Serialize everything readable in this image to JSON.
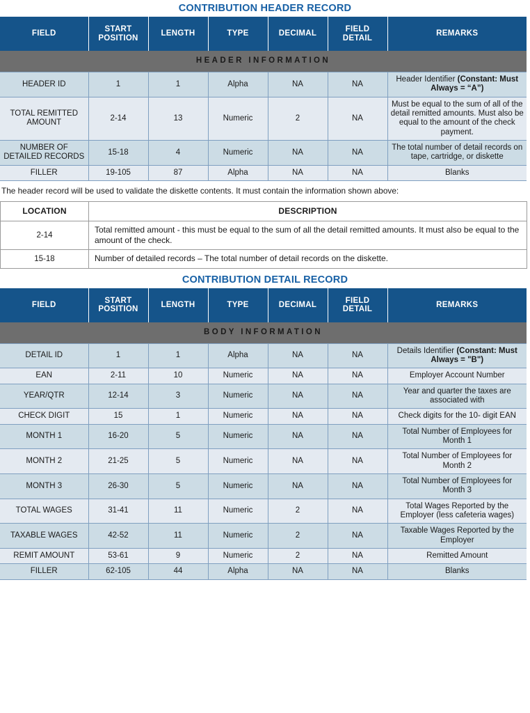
{
  "colors": {
    "header_blue": "#15548a",
    "title_blue": "#1760a5",
    "section_gray": "#6e6e6e",
    "row_dark": "#ccdce5",
    "row_light": "#e4eaf1",
    "grid_line": "#7f9fc0",
    "loc_grid_line": "#9a9a9a"
  },
  "header_table": {
    "title": "CONTRIBUTION HEADER RECORD",
    "columns": [
      "FIELD",
      "START POSITION",
      "LENGTH",
      "TYPE",
      "DECIMAL",
      "FIELD DETAIL",
      "REMARKS"
    ],
    "section_label": "HEADER INFORMATION",
    "rows": [
      {
        "field": "HEADER ID",
        "start_position": "1",
        "length": "1",
        "type": "Alpha",
        "decimal": "NA",
        "field_detail": "NA",
        "remarks_plain": "Header Identifier",
        "remarks_bold": "(Constant: Must Always = “A”)"
      },
      {
        "field": "TOTAL REMITTED AMOUNT",
        "start_position": "2-14",
        "length": "13",
        "type": "Numeric",
        "decimal": "2",
        "field_detail": "NA",
        "remarks_plain": "Must be equal to the sum of all of the detail remitted amounts. Must also be equal to the amount of the check payment.",
        "remarks_bold": ""
      },
      {
        "field": "NUMBER OF DETAILED RECORDS",
        "start_position": "15-18",
        "length": "4",
        "type": "Numeric",
        "decimal": "NA",
        "field_detail": "NA",
        "remarks_plain": "The total number of detail records on tape, cartridge, or diskette",
        "remarks_bold": ""
      },
      {
        "field": "FILLER",
        "start_position": "19-105",
        "length": "87",
        "type": "Alpha",
        "decimal": "NA",
        "field_detail": "NA",
        "remarks_plain": "Blanks",
        "remarks_bold": ""
      }
    ]
  },
  "note": "The header record will be used to validate the diskette contents. It must contain the information shown above:",
  "location_table": {
    "columns": [
      "LOCATION",
      "DESCRIPTION"
    ],
    "rows": [
      {
        "location": "2-14",
        "description": "Total remitted amount - this must be equal to the sum of all the detail remitted amounts.  It must also be equal to the amount of the check."
      },
      {
        "location": "15-18",
        "description": "Number of detailed records – The total number of detail records on the diskette."
      }
    ]
  },
  "detail_table": {
    "title": "CONTRIBUTION DETAIL RECORD",
    "columns": [
      "FIELD",
      "START POSITION",
      "LENGTH",
      "TYPE",
      "DECIMAL",
      "FIELD DETAIL",
      "REMARKS"
    ],
    "section_label": "BODY INFORMATION",
    "rows": [
      {
        "field": "DETAIL ID",
        "start_position": "1",
        "length": "1",
        "type": "Alpha",
        "decimal": "NA",
        "field_detail": "NA",
        "remarks_plain": "Details Identifier",
        "remarks_bold": "(Constant: Must Always = \"B\")"
      },
      {
        "field": "EAN",
        "start_position": "2-11",
        "length": "10",
        "type": "Numeric",
        "decimal": "NA",
        "field_detail": "NA",
        "remarks_plain": "Employer Account Number",
        "remarks_bold": ""
      },
      {
        "field": "YEAR/QTR",
        "start_position": "12-14",
        "length": "3",
        "type": "Numeric",
        "decimal": "NA",
        "field_detail": "NA",
        "remarks_plain": "Year and quarter the taxes are associated with",
        "remarks_bold": ""
      },
      {
        "field": "CHECK DIGIT",
        "start_position": "15",
        "length": "1",
        "type": "Numeric",
        "decimal": "NA",
        "field_detail": "NA",
        "remarks_plain": "Check digits for the 10-  digit EAN",
        "remarks_bold": ""
      },
      {
        "field": "MONTH 1",
        "start_position": "16-20",
        "length": "5",
        "type": "Numeric",
        "decimal": "NA",
        "field_detail": "NA",
        "remarks_plain": "Total Number of Employees for Month 1",
        "remarks_bold": ""
      },
      {
        "field": "MONTH 2",
        "start_position": "21-25",
        "length": "5",
        "type": "Numeric",
        "decimal": "NA",
        "field_detail": "NA",
        "remarks_plain": "Total Number of Employees for Month 2",
        "remarks_bold": ""
      },
      {
        "field": "MONTH 3",
        "start_position": "26-30",
        "length": "5",
        "type": "Numeric",
        "decimal": "NA",
        "field_detail": "NA",
        "remarks_plain": "Total Number of Employees for Month 3",
        "remarks_bold": ""
      },
      {
        "field": "TOTAL WAGES",
        "start_position": "31-41",
        "length": "11",
        "type": "Numeric",
        "decimal": "2",
        "field_detail": "NA",
        "remarks_plain": "Total Wages Reported by the Employer (less cafeteria wages)",
        "remarks_bold": ""
      },
      {
        "field": "TAXABLE WAGES",
        "start_position": "42-52",
        "length": "11",
        "type": "Numeric",
        "decimal": "2",
        "field_detail": "NA",
        "remarks_plain": "Taxable Wages Reported by the Employer",
        "remarks_bold": ""
      },
      {
        "field": "REMIT AMOUNT",
        "start_position": "53-61",
        "length": "9",
        "type": "Numeric",
        "decimal": "2",
        "field_detail": "NA",
        "remarks_plain": "Remitted Amount",
        "remarks_bold": ""
      },
      {
        "field": "FILLER",
        "start_position": "62-105",
        "length": "44",
        "type": "Alpha",
        "decimal": "NA",
        "field_detail": "NA",
        "remarks_plain": "Blanks",
        "remarks_bold": ""
      }
    ]
  }
}
